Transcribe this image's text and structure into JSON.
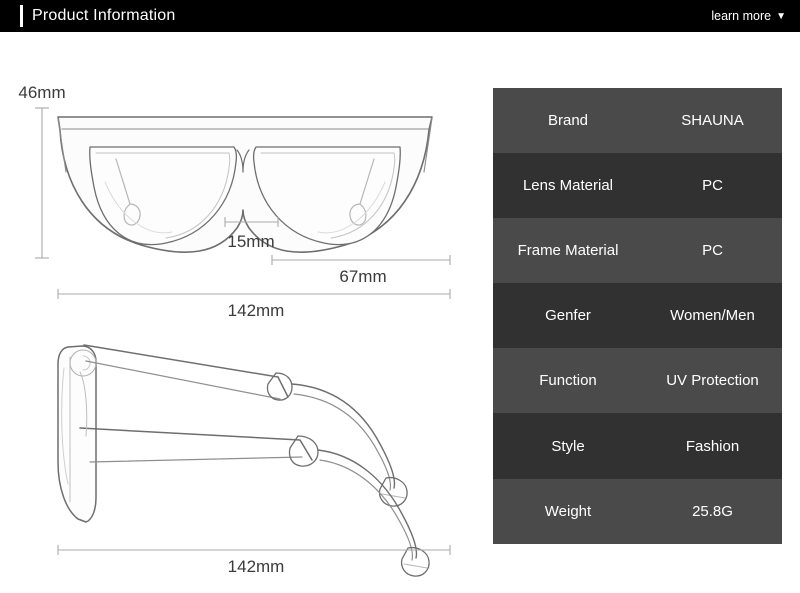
{
  "header": {
    "title": "Product Information",
    "learn_more_label": "learn more",
    "caret_glyph": "▼",
    "background_color": "#000000",
    "text_color": "#ffffff",
    "accent_bar_color": "#ffffff"
  },
  "diagram": {
    "front_view": {
      "height_label": "46mm",
      "bridge_label": "15mm",
      "lens_width_label": "67mm",
      "total_width_label": "142mm"
    },
    "side_view": {
      "temple_length_label": "142mm"
    },
    "line_color": "#aaaaaa",
    "sketch_color": "#6e6e6e",
    "text_color": "#3b3b3b"
  },
  "spec_table": {
    "row_color_light": "#4a4a4a",
    "row_color_dark": "#313131",
    "text_color": "#ffffff",
    "rows": [
      {
        "label": "Brand",
        "value": "SHAUNA"
      },
      {
        "label": "Lens Material",
        "value": "PC"
      },
      {
        "label": "Frame Material",
        "value": "PC"
      },
      {
        "label": "Genfer",
        "value": "Women/Men"
      },
      {
        "label": "Function",
        "value": "UV Protection"
      },
      {
        "label": "Style",
        "value": "Fashion"
      },
      {
        "label": "Weight",
        "value": "25.8G"
      }
    ]
  }
}
